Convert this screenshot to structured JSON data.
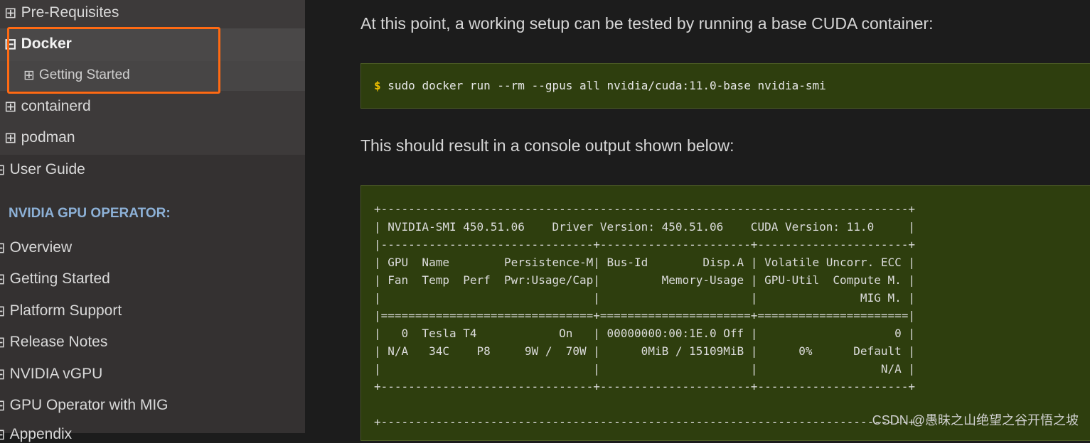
{
  "sidebar": {
    "nested_items": [
      {
        "label": "Pre-Requisites",
        "icon": "plus-box-icon"
      },
      {
        "label": "Docker",
        "icon": "minus-box-icon",
        "active": true
      },
      {
        "label": "Getting Started",
        "icon": "plus-box-icon"
      },
      {
        "label": "containerd",
        "icon": "plus-box-icon"
      },
      {
        "label": "podman",
        "icon": "plus-box-icon"
      }
    ],
    "user_guide": "User Guide",
    "caption": "NVIDIA GPU OPERATOR:",
    "operator_items": [
      {
        "label": "Overview"
      },
      {
        "label": "Getting Started"
      },
      {
        "label": "Platform Support"
      },
      {
        "label": "Release Notes"
      },
      {
        "label": "NVIDIA vGPU"
      },
      {
        "label": "GPU Operator with MIG"
      },
      {
        "label": "Appendix"
      }
    ],
    "expand_glyph": "⊞",
    "collapse_glyph": "⊟"
  },
  "content": {
    "intro": "At this point, a working setup can be tested by running a base CUDA container:",
    "prompt": "$",
    "command": "sudo docker run --rm --gpus all nvidia/cuda:11.0-base nvidia-smi",
    "result_text": "This should result in a console output shown below:",
    "console_lines": [
      "+-----------------------------------------------------------------------------+",
      "| NVIDIA-SMI 450.51.06    Driver Version: 450.51.06    CUDA Version: 11.0     |",
      "|-------------------------------+----------------------+----------------------+",
      "| GPU  Name        Persistence-M| Bus-Id        Disp.A | Volatile Uncorr. ECC |",
      "| Fan  Temp  Perf  Pwr:Usage/Cap|         Memory-Usage | GPU-Util  Compute M. |",
      "|                               |                      |               MIG M. |",
      "|===============================+======================+======================|",
      "|   0  Tesla T4            On   | 00000000:00:1E.0 Off |                    0 |",
      "| N/A   34C    P8     9W /  70W |      0MiB / 15109MiB |      0%      Default |",
      "|                               |                      |                  N/A |",
      "+-------------------------------+----------------------+----------------------+",
      "",
      "+-----------------------------------------------------------------------------+"
    ]
  },
  "watermark": "CSDN @愚昧之山绝望之谷开悟之坡",
  "colors": {
    "highlight": "#ff6a13",
    "code_bg": "#2e3e0e",
    "caption": "#8db1d7",
    "prompt": "#f0c000"
  }
}
